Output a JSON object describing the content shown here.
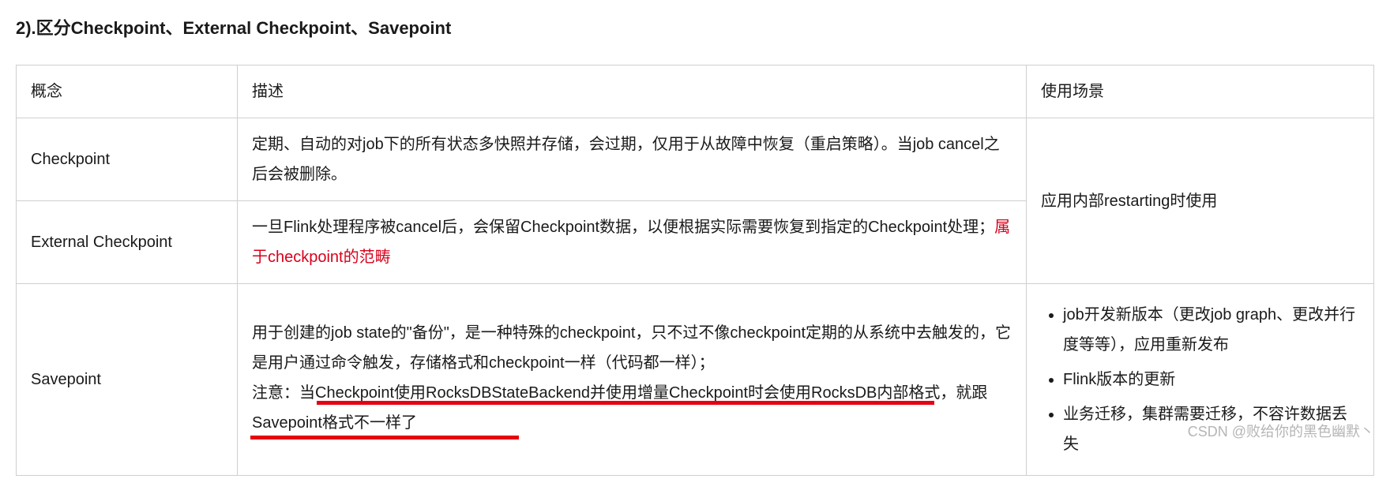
{
  "heading": "2).区分Checkpoint、External Checkpoint、Savepoint",
  "table": {
    "headers": {
      "col1": "概念",
      "col2": "描述",
      "col3": "使用场景"
    },
    "rows": {
      "checkpoint": {
        "name": "Checkpoint",
        "desc": "定期、自动的对job下的所有状态多快照并存储，会过期，仅用于从故障中恢复（重启策略）。当job cancel之后会被删除。"
      },
      "external": {
        "name": "External Checkpoint",
        "desc_prefix": "一旦Flink处理程序被cancel后，会保留Checkpoint数据，以便根据实际需要恢复到指定的Checkpoint处理；",
        "desc_red": "属于checkpoint的范畴"
      },
      "usage_merged_1_2": "应用内部restarting时使用",
      "savepoint": {
        "name": "Savepoint",
        "desc_part1": "用于创建的job state的\"备份\"，是一种特殊的checkpoint，只不过不像checkpoint定期的从系统中去触发的，它是用户通过命令触发，存储格式和checkpoint一样（代码都一样）；",
        "desc_note_prefix": "注意：",
        "desc_underlined": "当Checkpoint使用RocksDBStateBackend并使用增量Checkpoint时会使用RocksDB内部格式，就跟Savepoint格式不一样了",
        "usage_list": [
          "job开发新版本（更改job graph、更改并行度等等），应用重新发布",
          "Flink版本的更新",
          "业务迁移，集群需要迁移，不容许数据丢失"
        ]
      }
    }
  },
  "watermark": "CSDN @败给你的黑色幽默丶"
}
